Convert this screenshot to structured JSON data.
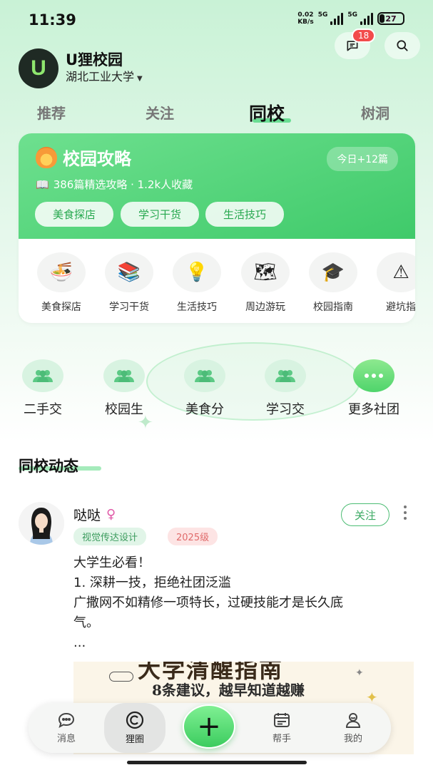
{
  "status_bar": {
    "time": "11:39",
    "net_speed_value": "0.02",
    "net_speed_unit": "KB/s",
    "sim1": "5G",
    "sim2": "5G",
    "battery": "27"
  },
  "header": {
    "logo_letter": "U",
    "app_name": "U狸校园",
    "school": "湖北工业大学",
    "message_badge": "18",
    "icons": [
      "chat-icon",
      "search-icon"
    ]
  },
  "tabs": [
    {
      "label": "推荐",
      "active": false
    },
    {
      "label": "关注",
      "active": false
    },
    {
      "label": "同校",
      "active": true
    },
    {
      "label": "树洞",
      "active": false
    }
  ],
  "guide_card": {
    "title": "校园攻略",
    "today": "今日+12篇",
    "stats": "386篇精选攻略 · 1.2k人收藏",
    "chips": [
      "美食探店",
      "学习干货",
      "生活技巧"
    ],
    "categories": [
      {
        "label": "美食探店",
        "icon": "🍜"
      },
      {
        "label": "学习干货",
        "icon": "📚"
      },
      {
        "label": "生活技巧",
        "icon": "💡"
      },
      {
        "label": "周边游玩",
        "icon": "🗺"
      },
      {
        "label": "校园指南",
        "icon": "🎓"
      },
      {
        "label": "避坑指",
        "icon": "⚠"
      }
    ]
  },
  "clubs": [
    {
      "label": "二手交",
      "icon": "people-icon"
    },
    {
      "label": "校园生",
      "icon": "people-icon"
    },
    {
      "label": "美食分",
      "icon": "people-icon"
    },
    {
      "label": "学习交",
      "icon": "people-icon"
    },
    {
      "label": "更多社团",
      "icon": "more-icon"
    }
  ],
  "section": {
    "title": "同校动态"
  },
  "post": {
    "author": "哒哒",
    "gender_symbol": "♀",
    "tags": [
      "视觉传达设计",
      "2025级"
    ],
    "follow_label": "关注",
    "lines": [
      "大学生必看！",
      "1. 深耕一技，拒绝社团泛滥",
      "广撒网不如精修一项特长，过硬技能才是长久底",
      "气。",
      "..."
    ],
    "image_title": "大学清醒指南",
    "image_subtitle": "8条建议，越早知道越赚"
  },
  "bottom_nav": {
    "items": [
      {
        "label": "消息",
        "icon": "message-icon"
      },
      {
        "label": "狸圈",
        "icon": "circle-icon"
      },
      {
        "label": "帮手",
        "icon": "helper-icon"
      },
      {
        "label": "我的",
        "icon": "profile-icon"
      }
    ],
    "fab": "+"
  },
  "colors": {
    "brand_green": "#3fca6a",
    "badge_red": "#f24b4b",
    "female_pink": "#e05aa8"
  }
}
